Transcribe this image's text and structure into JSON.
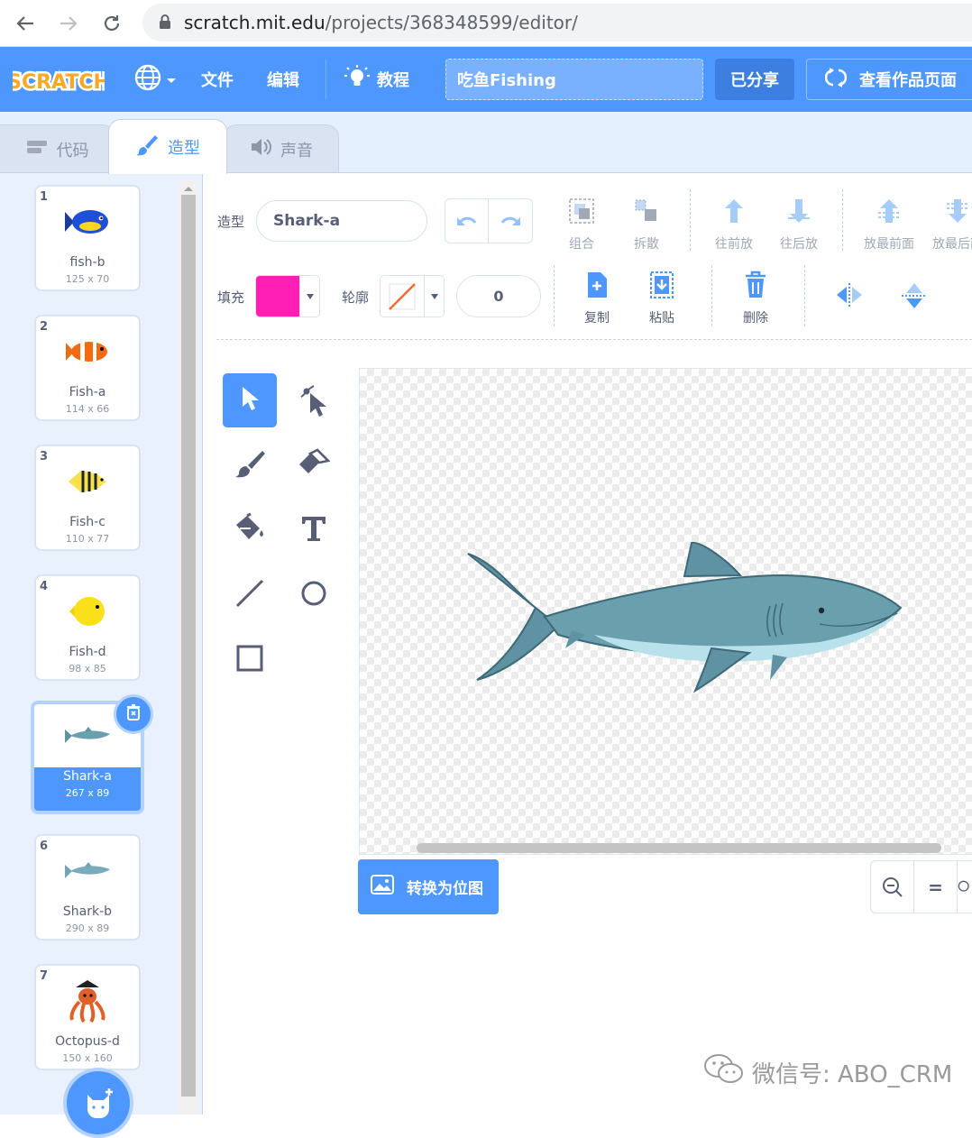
{
  "browser": {
    "url_host": "scratch.mit.edu",
    "url_path": "/projects/368348599/editor/"
  },
  "menubar": {
    "logo_text": "SCRATCH",
    "file": "文件",
    "edit": "编辑",
    "tutorials": "教程",
    "project_title": "吃鱼Fishing",
    "shared": "已分享",
    "see_project_page": "查看作品页面"
  },
  "tabs": {
    "code": "代码",
    "costumes": "造型",
    "sounds": "声音"
  },
  "costumes": [
    {
      "num": "1",
      "name": "fish-b",
      "size": "125 x 70"
    },
    {
      "num": "2",
      "name": "Fish-a",
      "size": "114 x 66"
    },
    {
      "num": "3",
      "name": "Fish-c",
      "size": "110 x 77"
    },
    {
      "num": "4",
      "name": "Fish-d",
      "size": "98 x 85"
    },
    {
      "num": "5",
      "name": "Shark-a",
      "size": "267 x 89"
    },
    {
      "num": "6",
      "name": "Shark-b",
      "size": "290 x 89"
    },
    {
      "num": "7",
      "name": "Octopus-d",
      "size": "150 x 160"
    }
  ],
  "selected_costume": "5",
  "editor": {
    "costume_label": "造型",
    "costume_name": "Shark-a",
    "group": "组合",
    "ungroup": "拆散",
    "forward": "往前放",
    "backward": "往后放",
    "front": "放最前面",
    "back": "放最后面",
    "fill_label": "填充",
    "outline_label": "轮廓",
    "outline_width": "0",
    "copy": "复制",
    "paste": "粘贴",
    "delete": "删除",
    "convert_bitmap": "转换为位图",
    "zoom_reset": "="
  },
  "colors": {
    "accent": "#4d97ff",
    "fill": "#ff1fb4",
    "outline": "none"
  },
  "watermark": "微信号: ABO_CRM"
}
